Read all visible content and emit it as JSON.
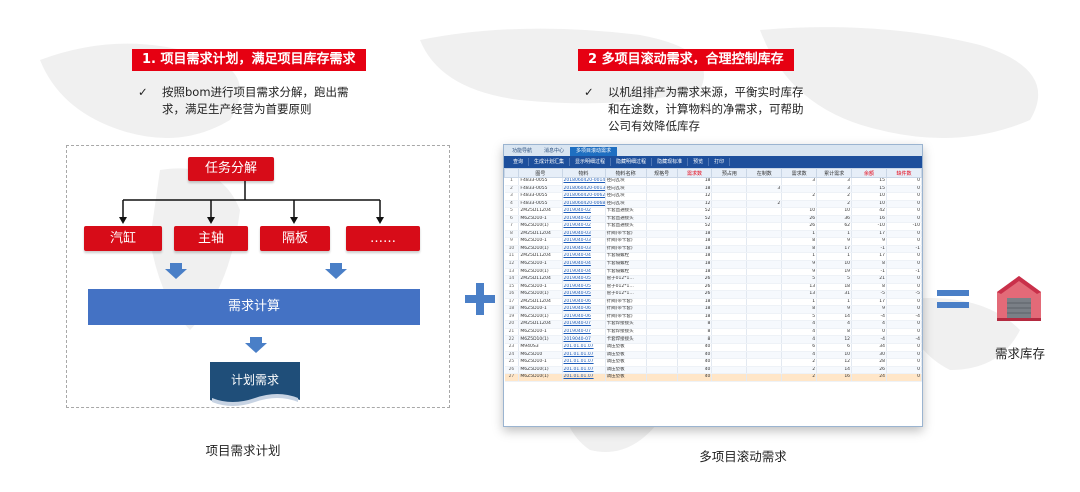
{
  "left": {
    "banner": "1. 项目需求计划，满足项目库存需求",
    "bullet_mark": "✓",
    "bullet_line1": "按照bom进行项目需求分解，跑出需",
    "bullet_line2": "求，满足生产经营为首要原则",
    "diagram": {
      "root": "任务分解",
      "children": [
        "汽缸",
        "主轴",
        "隔板",
        "……"
      ],
      "calc": "需求计算",
      "plan": "计划需求"
    },
    "caption": "项目需求计划"
  },
  "right": {
    "banner": "2 多项目滚动需求，合理控制库存",
    "bullet_mark": "✓",
    "bullet_line1": "以机组排产为需求来源，平衡实时库存",
    "bullet_line2": "和在途数，计算物料的净需求，可帮助",
    "bullet_line3": "公司有效降低库存",
    "caption": "多项目滚动需求"
  },
  "result_label": "需求库存",
  "app": {
    "tabs": [
      "功能导航",
      "消息中心",
      "多项目滚动需求"
    ],
    "toolbar": [
      "查询",
      "生成计划汇集",
      "显示明细过程",
      "隐藏明细过程",
      "隐藏现标准",
      "预览",
      "打印"
    ],
    "columns": [
      "",
      "图号",
      "物料",
      "物料名称",
      "规格号",
      "需求数",
      "预占用",
      "在制数",
      "需求数",
      "累计需求",
      "余额",
      "缺件数"
    ],
    "rows": [
      [
        "1",
        "F4833-0055",
        "2018060420-0014",
        "径向瓦块",
        "",
        "18",
        "",
        "",
        "3",
        "3",
        "15",
        "0"
      ],
      [
        "2",
        "F4833-0055",
        "2018060420-0013",
        "径向瓦块",
        "",
        "18",
        "",
        "3",
        "",
        "3",
        "15",
        "0"
      ],
      [
        "3",
        "F4833-0055",
        "2018060420-0062",
        "径向瓦块",
        "",
        "12",
        "",
        "",
        "2",
        "2",
        "10",
        "0"
      ],
      [
        "4",
        "F4833-0055",
        "2018060420-0068",
        "径向瓦块",
        "",
        "12",
        "",
        "2",
        "",
        "2",
        "10",
        "0"
      ],
      [
        "5",
        "2M25D11Z04",
        "2019040-02",
        "卡套直通接头",
        "",
        "52",
        "",
        "",
        "10",
        "10",
        "42",
        "0"
      ],
      [
        "6",
        "M6Z5D10-1",
        "2019040-02",
        "卡套直通接头",
        "",
        "52",
        "",
        "",
        "26",
        "36",
        "16",
        "0"
      ],
      [
        "7",
        "M6Z5D10(1)",
        "2019040-02",
        "卡套直通接头",
        "",
        "52",
        "",
        "",
        "26",
        "62",
        "-10",
        "-10"
      ],
      [
        "8",
        "2M25D11Z04",
        "2019040-03",
        "针阀(带卡套)",
        "",
        "18",
        "",
        "",
        "1",
        "1",
        "17",
        "0"
      ],
      [
        "9",
        "M6Z5D10-1",
        "2019040-03",
        "针阀(带卡套)",
        "",
        "18",
        "",
        "",
        "8",
        "9",
        "9",
        "0"
      ],
      [
        "10",
        "M6Z5D10(1)",
        "2019040-03",
        "针阀(带卡套)",
        "",
        "18",
        "",
        "",
        "8",
        "17",
        "-1",
        "-1"
      ],
      [
        "11",
        "2M25D11Z04",
        "2019040-04",
        "卡套隔螺栓",
        "",
        "18",
        "",
        "",
        "1",
        "1",
        "17",
        "0"
      ],
      [
        "12",
        "M6Z5D10-1",
        "2019040-04",
        "卡套隔螺栓",
        "",
        "18",
        "",
        "",
        "9",
        "10",
        "8",
        "0"
      ],
      [
        "13",
        "M6Z5D10(1)",
        "2019040-04",
        "卡套隔螺栓",
        "",
        "18",
        "",
        "",
        "9",
        "19",
        "-1",
        "-1"
      ],
      [
        "14",
        "2M25D11Z04",
        "2019040-05",
        "管子012*1…",
        "",
        "26",
        "",
        "",
        "5",
        "5",
        "21",
        "0"
      ],
      [
        "15",
        "M6Z5D10-1",
        "2019040-05",
        "管子012*1…",
        "",
        "26",
        "",
        "",
        "13",
        "18",
        "8",
        "0"
      ],
      [
        "16",
        "M6Z5D10(1)",
        "2019040-05",
        "管子012*1…",
        "",
        "26",
        "",
        "",
        "13",
        "31",
        "-5",
        "-5"
      ],
      [
        "17",
        "2M25D11Z04",
        "2019040-06",
        "针阀(带卡套)",
        "",
        "18",
        "",
        "",
        "1",
        "1",
        "17",
        "0"
      ],
      [
        "18",
        "M6Z5D10-1",
        "2019040-06",
        "针阀(带卡套)",
        "",
        "18",
        "",
        "",
        "8",
        "9",
        "9",
        "0"
      ],
      [
        "19",
        "M6Z5D10(1)",
        "2019040-06",
        "针阀(带卡套)",
        "",
        "18",
        "",
        "",
        "5",
        "14",
        "-4",
        "-4"
      ],
      [
        "20",
        "2M25D11Z04",
        "2019040-07",
        "卡套焊接接头",
        "",
        "8",
        "",
        "",
        "4",
        "4",
        "4",
        "0"
      ],
      [
        "21",
        "M6Z5D10-1",
        "2019040-07",
        "卡套焊接接头",
        "",
        "8",
        "",
        "",
        "4",
        "8",
        "0",
        "0"
      ],
      [
        "22",
        "M6Z5D10(1)",
        "2019040-07",
        "卡套焊接接头",
        "",
        "8",
        "",
        "",
        "4",
        "12",
        "-4",
        "-4"
      ],
      [
        "23",
        "M940S3",
        "201.01.01.07",
        "调压垫板",
        "",
        "40",
        "",
        "",
        "6",
        "6",
        "34",
        "0"
      ],
      [
        "24",
        "M6Z5D10",
        "201.01.01.07",
        "调压垫板",
        "",
        "40",
        "",
        "",
        "4",
        "10",
        "30",
        "0"
      ],
      [
        "25",
        "M6Z5D10-1",
        "201.01.01.07",
        "调压垫板",
        "",
        "40",
        "",
        "",
        "2",
        "12",
        "28",
        "0"
      ],
      [
        "26",
        "M6Z5D10(1)",
        "201.01.01.07",
        "调压垫板",
        "",
        "40",
        "",
        "",
        "2",
        "14",
        "26",
        "0"
      ],
      [
        "27",
        "M6Z5D10(1)",
        "201.01.01.07",
        "调压垫板",
        "",
        "40",
        "",
        "",
        "2",
        "16",
        "24",
        "0"
      ]
    ]
  },
  "colors": {
    "banner_red": "#e60012",
    "box_red": "#d70c18",
    "blue": "#4472c4",
    "arrow_blue": "#4a7fc7",
    "doc_navy": "#1f4e79"
  },
  "icons": {
    "plus": "plus-icon",
    "equals": "equals-icon",
    "warehouse": "warehouse-icon"
  }
}
